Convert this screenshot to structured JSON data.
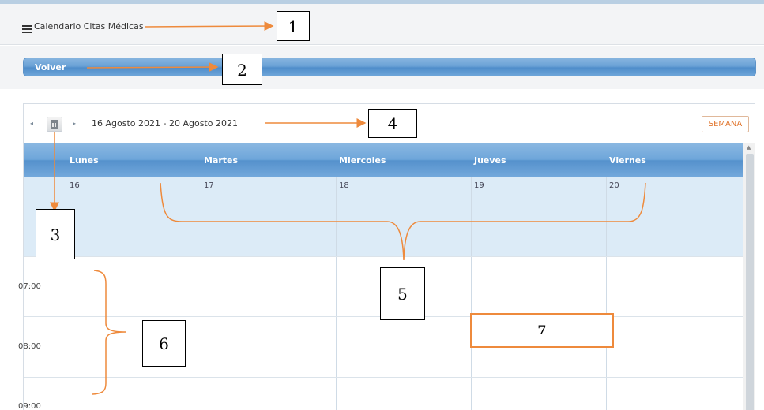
{
  "header": {
    "title": "Calendario Citas Médicas"
  },
  "back_button": {
    "label": "Volver"
  },
  "toolbar": {
    "prev_icon": "◂",
    "next_icon": "▸",
    "date_range": "16 Agosto 2021 - 20 Agosto 2021",
    "view_button": "SEMANA"
  },
  "days": [
    {
      "name": "Lunes",
      "num": "16"
    },
    {
      "name": "Martes",
      "num": "17"
    },
    {
      "name": "Miercoles",
      "num": "18"
    },
    {
      "name": "Jueves",
      "num": "19"
    },
    {
      "name": "Viernes",
      "num": "20"
    }
  ],
  "times": [
    "07:00",
    "08:00",
    "09:00"
  ],
  "annotations": [
    "1",
    "2",
    "3",
    "4",
    "5",
    "6",
    "7"
  ],
  "colors": {
    "accent": "#4f8dca",
    "annotation_arrow": "#ee8a3c",
    "allday_bg": "#dcebf7"
  }
}
